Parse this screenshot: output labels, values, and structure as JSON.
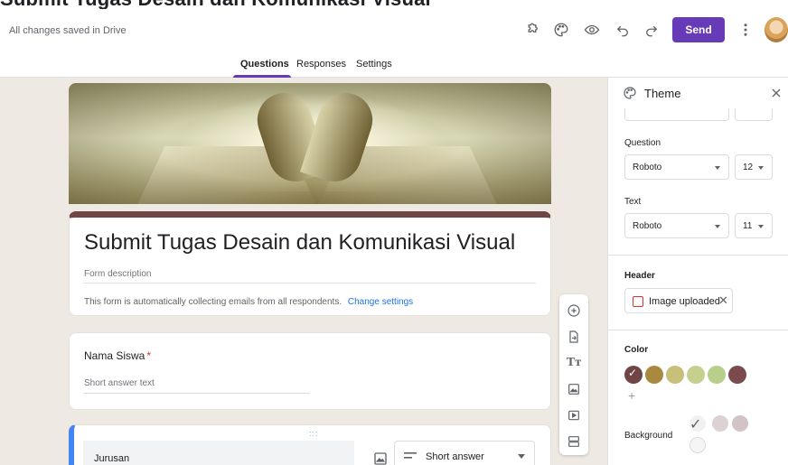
{
  "page_title": "Submit Tugas Desain dan Komunikasi Visual",
  "topbar": {
    "saved_status": "All changes saved in Drive",
    "icons": [
      "addon-puzzle-icon",
      "palette-icon",
      "eye-preview-icon",
      "undo-icon",
      "redo-icon",
      "more-vert-icon"
    ],
    "send_label": "Send"
  },
  "tabs": [
    {
      "label": "Questions",
      "active": true
    },
    {
      "label": "Responses",
      "active": false
    },
    {
      "label": "Settings",
      "active": false
    }
  ],
  "form": {
    "title": "Submit Tugas Desain dan Komunikasi Visual",
    "description_placeholder": "Form description",
    "collect_notice": "This form is automatically collecting emails from all respondents.",
    "change_settings": "Change settings"
  },
  "questions": [
    {
      "label": "Nama Siswa",
      "required_mark": "*",
      "answer_placeholder": "Short answer text"
    },
    {
      "label": "Jurusan",
      "type": "Short answer",
      "drag_handle": ":::"
    }
  ],
  "theme_panel": {
    "title": "Theme",
    "question_label": "Question",
    "question_font": "Roboto",
    "question_size": "12",
    "text_label": "Text",
    "text_font": "Roboto",
    "text_size": "11",
    "header_label": "Header",
    "header_chip": "Image uploaded",
    "color_label": "Color",
    "colors": [
      "#6f4545",
      "#a8893f",
      "#c8c078",
      "#c7cf8f",
      "#b8cf8c",
      "#7a4a4f"
    ],
    "selected_color": 0,
    "background_label": "Background",
    "backgrounds": [
      "#efe9e3",
      "#ddd2d2",
      "#d2c4c4",
      "#f5f5f5"
    ],
    "selected_background": 0,
    "accent": "#673ab7"
  }
}
